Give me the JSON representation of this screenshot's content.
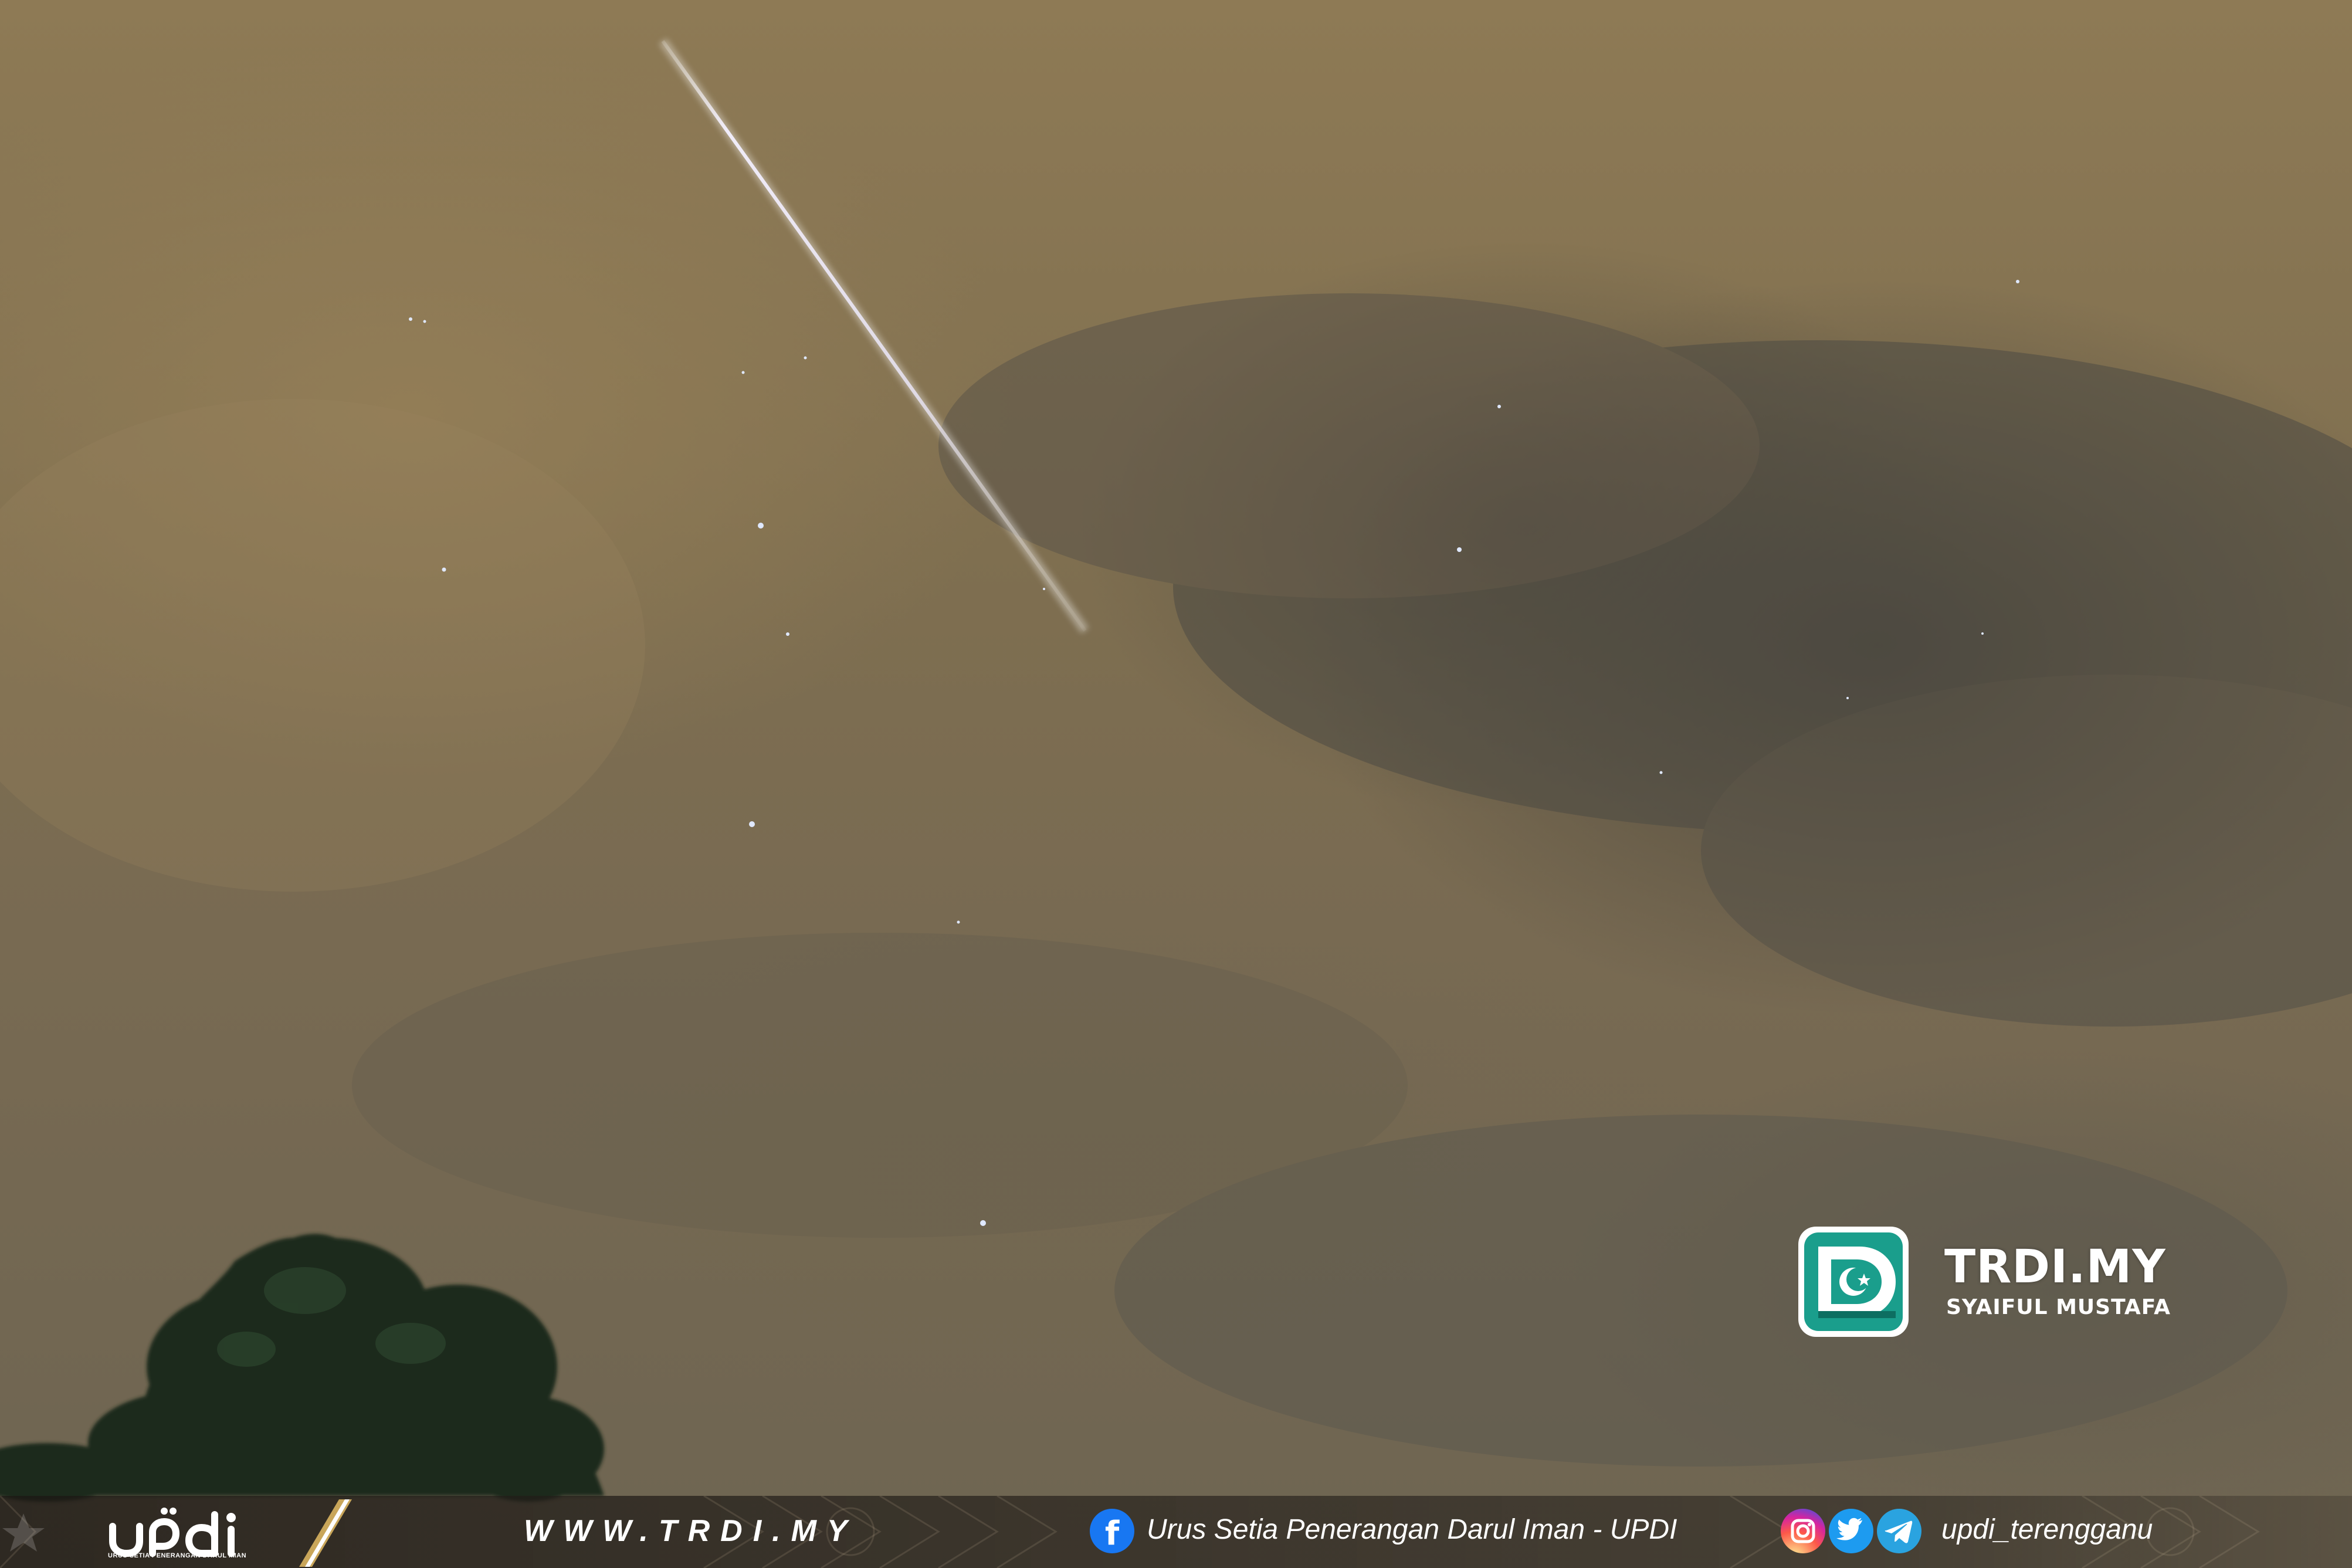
{
  "watermark": {
    "title": "TRDI.MY",
    "credit": "SYAIFUL MUSTAFA",
    "colors": {
      "logo_teal": "#1a9e8c",
      "logo_text": "#ffffff"
    }
  },
  "footer": {
    "updi_caption": "URUS SETIA PENERANGAN DARUL IMAN",
    "website": "WWW.TRDI.MY",
    "facebook_label": "Urus Setia Penerangan Darul Iman - UPDI",
    "social_handle": "updi_terengganu",
    "icons": [
      "facebook-icon",
      "instagram-icon",
      "twitter-icon",
      "telegram-icon"
    ],
    "colors": {
      "facebook": "#1877f2",
      "twitter": "#1d9bf0",
      "telegram": "#2aa3e0"
    }
  }
}
